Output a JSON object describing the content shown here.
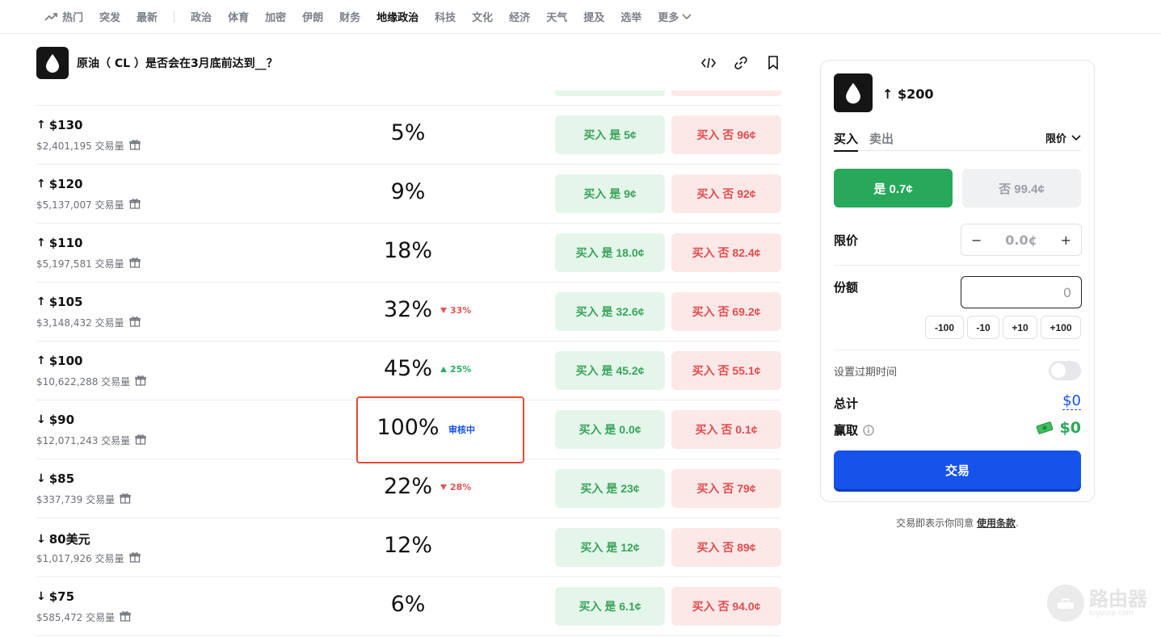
{
  "nav": {
    "items": [
      "热门",
      "突发",
      "最新",
      "政治",
      "体育",
      "加密",
      "伊朗",
      "财务",
      "地缘政治",
      "科技",
      "文化",
      "经济",
      "天气",
      "提及",
      "选举"
    ],
    "more": "更多",
    "active": "地缘政治"
  },
  "market": {
    "title": "原油（ CL ）是否会在3月底前达到__？"
  },
  "rows": [
    {
      "label": "$130",
      "dir": "up",
      "volume": "$2,401,195 交易量",
      "pct": "5%",
      "change": "",
      "yes": "买入 是 5¢",
      "no": "买入 否 96¢"
    },
    {
      "label": "$120",
      "dir": "up",
      "volume": "$5,137,007 交易量",
      "pct": "9%",
      "change": "",
      "yes": "买入 是 9¢",
      "no": "买入 否 92¢"
    },
    {
      "label": "$110",
      "dir": "up",
      "volume": "$5,197,581 交易量",
      "pct": "18%",
      "change": "",
      "yes": "买入 是 18.0¢",
      "no": "买入 否 82.4¢"
    },
    {
      "label": "$105",
      "dir": "up",
      "volume": "$3,148,432 交易量",
      "pct": "32%",
      "change": "33%",
      "changeDir": "down",
      "yes": "买入 是 32.6¢",
      "no": "买入 否 69.2¢"
    },
    {
      "label": "$100",
      "dir": "up",
      "volume": "$10,622,288 交易量",
      "pct": "45%",
      "change": "25%",
      "changeDir": "up",
      "yes": "买入 是 45.2¢",
      "no": "买入 否 55.1¢"
    },
    {
      "label": "$90",
      "dir": "down",
      "volume": "$12,071,243 交易量",
      "pct": "100%",
      "change": "审核中",
      "changeDir": "review",
      "yes": "买入 是 0.0¢",
      "no": "买入 否 0.1¢"
    },
    {
      "label": "$85",
      "dir": "down",
      "volume": "$337,739 交易量",
      "pct": "22%",
      "change": "28%",
      "changeDir": "down",
      "yes": "买入 是 23¢",
      "no": "买入 否 79¢"
    },
    {
      "label": "80美元",
      "dir": "down",
      "volume": "$1,017,926 交易量",
      "pct": "12%",
      "change": "",
      "yes": "买入 是 12¢",
      "no": "买入 否 89¢"
    },
    {
      "label": "$75",
      "dir": "down",
      "volume": "$585,472 交易量",
      "pct": "6%",
      "change": "",
      "yes": "买入 是 6.1¢",
      "no": "买入 否 94.0¢"
    }
  ],
  "panel": {
    "title": "$200",
    "tab_buy": "买入",
    "tab_sell": "卖出",
    "order_type": "限价",
    "yes_label": "是 0.7¢",
    "no_label": "否 99.4¢",
    "limit_label": "限价",
    "limit_value": "0.0¢",
    "minus": "−",
    "plus": "+",
    "shares_label": "份额",
    "shares_value": "0",
    "quick": [
      "-100",
      "-10",
      "+10",
      "+100"
    ],
    "expiry_label": "设置过期时间",
    "total_label": "总计",
    "total_value": "$0",
    "win_label": "赢取",
    "win_value": "$0",
    "trade_label": "交易"
  },
  "terms": {
    "text": "交易即表示你同意 ",
    "link": "使用条款",
    "end": "."
  },
  "watermark": {
    "title": "路由器",
    "sub": "luyouqi.com"
  },
  "colors": {
    "accent": "#1553ea",
    "yes": "#27a85a",
    "no": "#e14d4d",
    "highlight": "#e34b3a"
  }
}
